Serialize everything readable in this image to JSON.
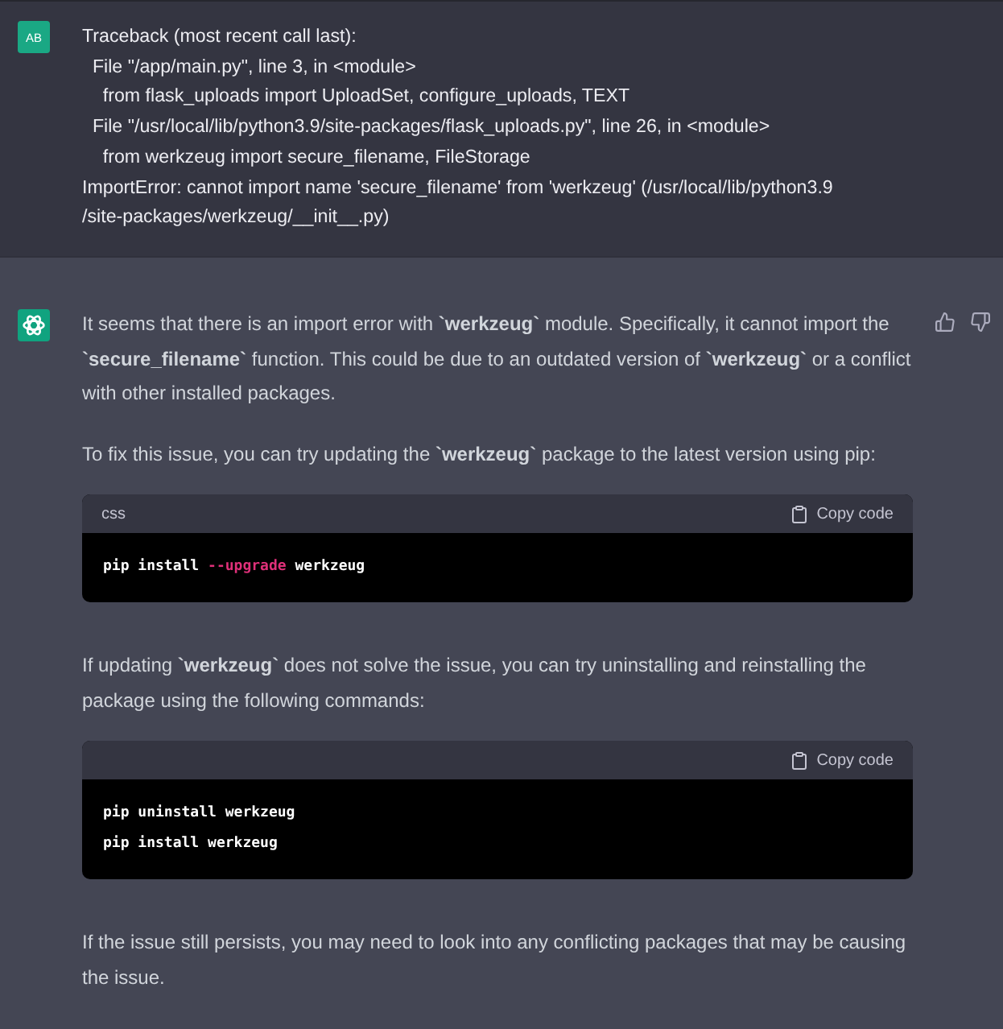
{
  "user_message": {
    "avatar_initials": "AB",
    "text": "Traceback (most recent call last):\n  File \"/app/main.py\", line 3, in <module>\n    from flask_uploads import UploadSet, configure_uploads, TEXT\n  File \"/usr/local/lib/python3.9/site-packages/flask_uploads.py\", line 26, in <module>\n    from werkzeug import secure_filename, FileStorage\nImportError: cannot import name 'secure_filename' from 'werkzeug' (/usr/local/lib/python3.9\n/site-packages/werkzeug/__init__.py)"
  },
  "assistant_message": {
    "blocks": [
      {
        "kind": "paragraph",
        "text": "It seems that there is an import error with **`werkzeug`** module. Specifically, it cannot import the **`secure_filename`** function. This could be due to an outdated version of **`werkzeug`** or a conflict with other installed packages."
      },
      {
        "kind": "paragraph",
        "text": "To fix this issue, you can try updating the **`werkzeug`** package to the latest version using pip:"
      },
      {
        "kind": "code",
        "language": "css",
        "copy_label": "Copy code",
        "lines": [
          [
            {
              "kind": "plain",
              "text": "pip install "
            },
            {
              "kind": "flag",
              "text": "--upgrade"
            },
            {
              "kind": "plain",
              "text": " werkzeug"
            }
          ]
        ]
      },
      {
        "kind": "paragraph",
        "text": "If updating **`werkzeug`** does not solve the issue, you can try uninstalling and reinstalling the package using the following commands:"
      },
      {
        "kind": "code",
        "copy_label": "Copy code",
        "lines": [
          [
            {
              "kind": "plain",
              "text": "pip uninstall werkzeug"
            }
          ],
          [
            {
              "kind": "plain",
              "text": "pip install werkzeug"
            }
          ]
        ]
      },
      {
        "kind": "paragraph",
        "text": "If the issue still persists, you may need to look into any conflicting packages that may be causing the issue."
      }
    ]
  }
}
